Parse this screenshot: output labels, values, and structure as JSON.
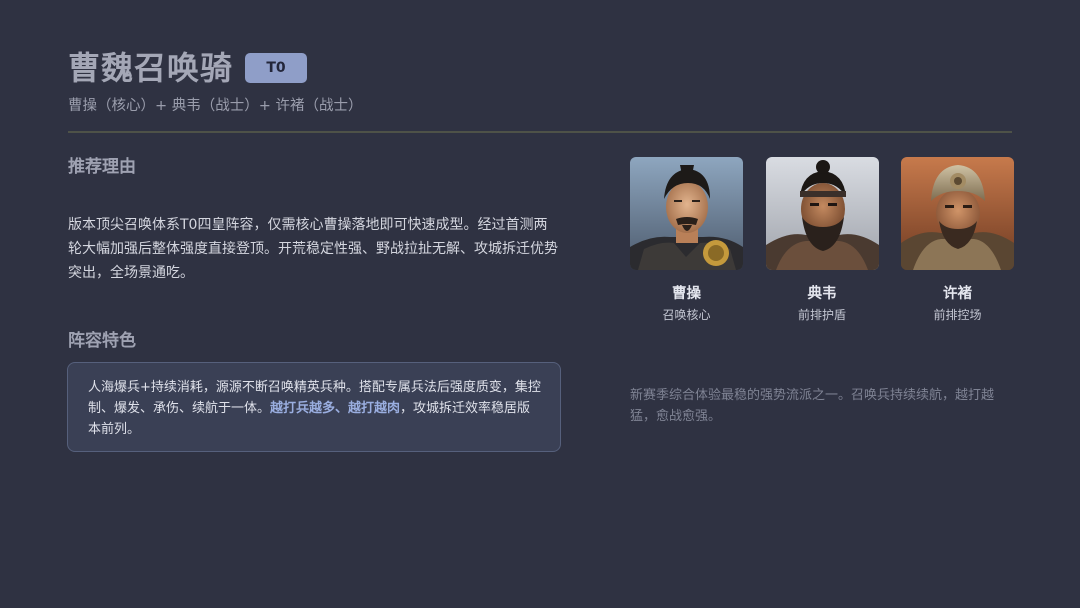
{
  "header": {
    "title": "曹魏召唤骑",
    "tier": "T0",
    "subtitle": "曹操（核心）+ 典韦（战士）+ 许褚（战士）"
  },
  "reason": {
    "heading": "推荐理由",
    "body": "版本顶尖召唤体系T0四皇阵容，仅需核心曹操落地即可快速成型。经过首测两轮大幅加强后整体强度直接登顶。开荒稳定性强、野战拉扯无解、攻城拆迁优势突出，全场景通吃。"
  },
  "features": {
    "heading": "阵容特色",
    "text_before": "人海爆兵+持续消耗，源源不断召唤精英兵种。搭配专属兵法后强度质变，集控制、爆发、承伤、续航于一体。",
    "highlight": "越打兵越多、越打越肉",
    "text_after": "，攻城拆迁效率稳居版本前列。"
  },
  "heroes": [
    {
      "name": "曹操",
      "role": "召唤核心",
      "icon": "caocao-portrait-image"
    },
    {
      "name": "典韦",
      "role": "前排护盾",
      "icon": "dianwei-portrait-image"
    },
    {
      "name": "许褚",
      "role": "前排控场",
      "icon": "xuchu-portrait-image"
    }
  ],
  "note": "新赛季综合体验最稳的强势流派之一。召唤兵持续续航，越打越猛，愈战愈强。",
  "colors": {
    "background": "#2f3242",
    "tier_badge": "#8f9ec8",
    "highlight": "#9aaee0",
    "divider": "#4e5248"
  }
}
